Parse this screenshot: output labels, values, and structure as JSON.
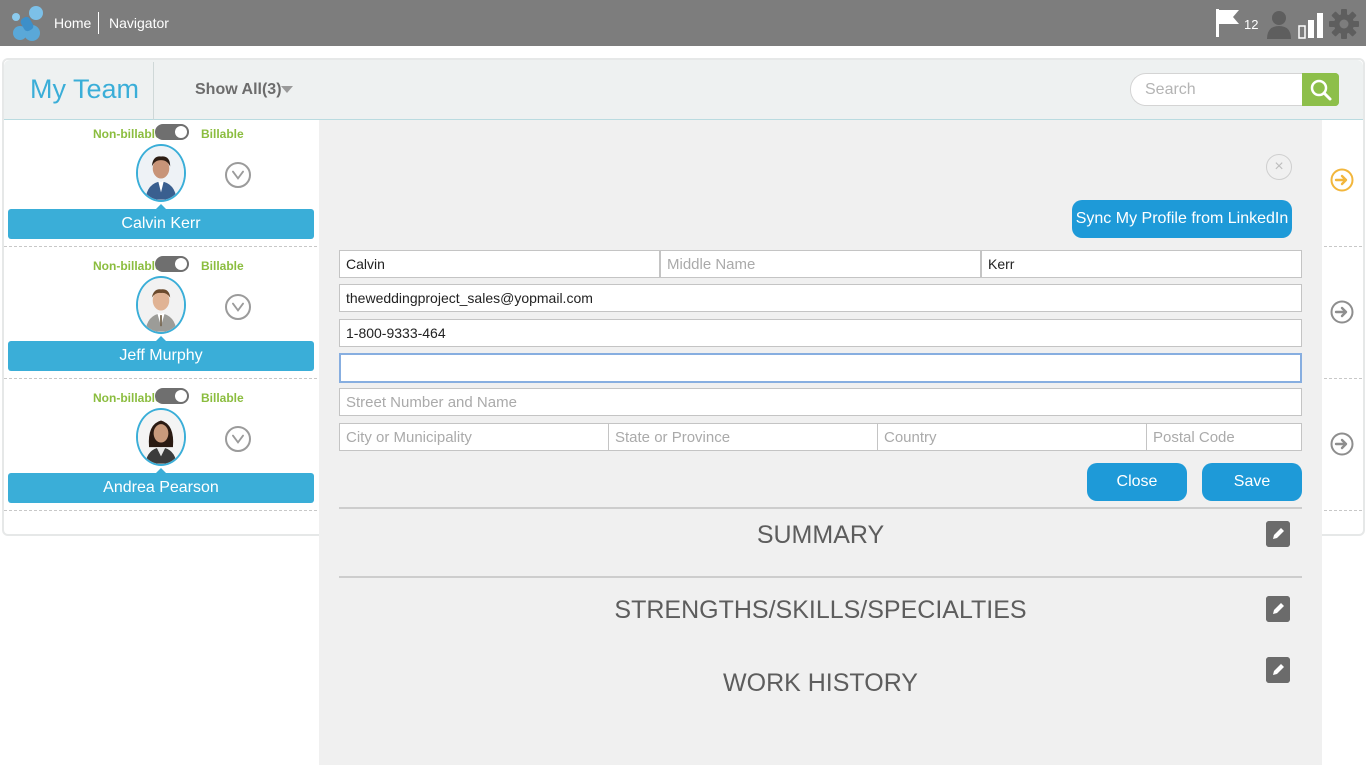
{
  "topbar": {
    "home": "Home",
    "navigator": "Navigator",
    "flag_count": "12",
    "icons": [
      "app-logo-icon",
      "flag-icon",
      "user-icon",
      "signal-bars-icon",
      "gear-icon"
    ]
  },
  "team": {
    "title": "My Team",
    "filter": "Show All(3)",
    "search_placeholder": "Search"
  },
  "members": [
    {
      "name": "Calvin Kerr",
      "toggle_left": "Non-billable",
      "toggle_right": "Billable"
    },
    {
      "name": "Jeff Murphy",
      "toggle_left": "Non-billable",
      "toggle_right": "Billable"
    },
    {
      "name": "Andrea Pearson",
      "toggle_left": "Non-billable",
      "toggle_right": "Billable"
    }
  ],
  "editor": {
    "close_symbol": "×",
    "sync_label": "Sync My Profile from LinkedIn",
    "first_name": "Calvin",
    "middle_placeholder": "Middle Name",
    "last_name": "Kerr",
    "email": "theweddingproject_sales@yopmail.com",
    "phone": "1-800-9333-464",
    "blank_value": "",
    "street_placeholder": "Street Number and Name",
    "city_placeholder": "City or Municipality",
    "state_placeholder": "State or Province",
    "country_placeholder": "Country",
    "postal_placeholder": "Postal Code",
    "close_label": "Close",
    "save_label": "Save",
    "sections": [
      "SUMMARY",
      "STRENGTHS/SKILLS/SPECIALTIES",
      "WORK HISTORY"
    ]
  },
  "colors": {
    "topbar": "#7d7d7d",
    "accent_blue": "#3aaed8",
    "button_blue": "#1e9ad8",
    "green": "#8bbd3f",
    "active_arrow": "#f2b63c"
  }
}
